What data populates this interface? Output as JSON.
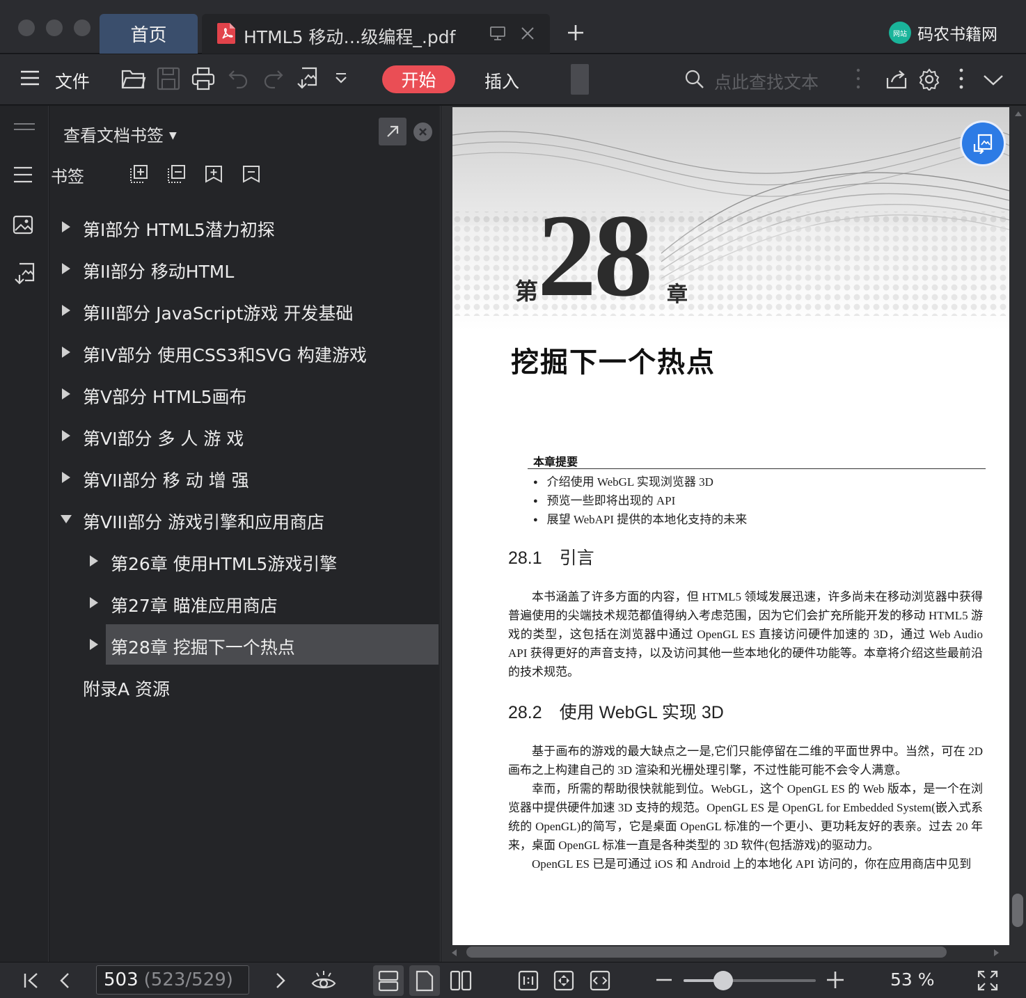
{
  "tabs": {
    "home": "首页",
    "document": "HTML5 移动…级编程_.pdf",
    "brand_name": "码农书籍网",
    "brand_badge": "网站"
  },
  "toolbar": {
    "file_label": "文件",
    "start_label": "开始",
    "insert_label": "插入",
    "search_placeholder": "点此查找文本"
  },
  "panel": {
    "header": "查看文档书签",
    "bookmark_label": "书签"
  },
  "bookmarks": [
    {
      "label": "第I部分 HTML5潜力初探",
      "expanded": false,
      "level": 0
    },
    {
      "label": "第II部分 移动HTML",
      "expanded": false,
      "level": 0
    },
    {
      "label": "第III部分 JavaScript游戏 开发基础",
      "expanded": false,
      "level": 0
    },
    {
      "label": "第IV部分 使用CSS3和SVG 构建游戏",
      "expanded": false,
      "level": 0
    },
    {
      "label": "第V部分 HTML5画布",
      "expanded": false,
      "level": 0
    },
    {
      "label": "第VI部分 多 人 游 戏",
      "expanded": false,
      "level": 0
    },
    {
      "label": "第VII部分 移 动 增 强",
      "expanded": false,
      "level": 0
    },
    {
      "label": "第VIII部分 游戏引擎和应用商店",
      "expanded": true,
      "level": 0
    },
    {
      "label": "第26章 使用HTML5游戏引擎",
      "expanded": false,
      "level": 1
    },
    {
      "label": "第27章 瞄准应用商店",
      "expanded": false,
      "level": 1
    },
    {
      "label": "第28章 挖掘下一个热点",
      "expanded": false,
      "level": 1,
      "selected": true
    },
    {
      "label": "附录A 资源",
      "leaf": true,
      "level": 0
    }
  ],
  "document_page": {
    "chapter_prefix": "第",
    "chapter_number": "28",
    "chapter_suffix": "章",
    "chapter_title": "挖掘下一个热点",
    "summary_heading": "本章提要",
    "summary_items": [
      "介绍使用 WebGL 实现浏览器 3D",
      "预览一些即将出现的 API",
      "展望 WebAPI 提供的本地化支持的未来"
    ],
    "section1_heading": "28.1　引言",
    "section1_body": "本书涵盖了许多方面的内容，但 HTML5 领域发展迅速，许多尚未在移动浏览器中获得普遍使用的尖端技术规范都值得纳入考虑范围，因为它们会扩充所能开发的移动 HTML5 游戏的类型，这包括在浏览器中通过 OpenGL ES 直接访问硬件加速的 3D，通过 Web Audio API 获得更好的声音支持，以及访问其他一些本地化的硬件功能等。本章将介绍这些最前沿的技术规范。",
    "section2_heading": "28.2　使用 WebGL 实现 3D",
    "section2_p1": "基于画布的游戏的最大缺点之一是,它们只能停留在二维的平面世界中。当然，可在 2D 画布之上构建自己的 3D 渲染和光栅处理引擎，不过性能可能不会令人满意。",
    "section2_p2": "幸而，所需的帮助很快就能到位。WebGL，这个 OpenGL ES 的 Web 版本，是一个在浏览器中提供硬件加速 3D 支持的规范。OpenGL ES 是 OpenGL for Embedded System(嵌入式系统的 OpenGL)的简写，它是桌面 OpenGL 标准的一个更小、更功耗友好的表亲。过去 20 年来，桌面 OpenGL 标准一直是各种类型的 3D 软件(包括游戏)的驱动力。",
    "section2_p3": "OpenGL ES 已是可通过 iOS 和 Android 上的本地化 API 访问的，你在应用商店中见到"
  },
  "statusbar": {
    "current_page": "503",
    "page_position": "(523/529)",
    "zoom_percent": 53,
    "zoom_text": "53 %"
  }
}
